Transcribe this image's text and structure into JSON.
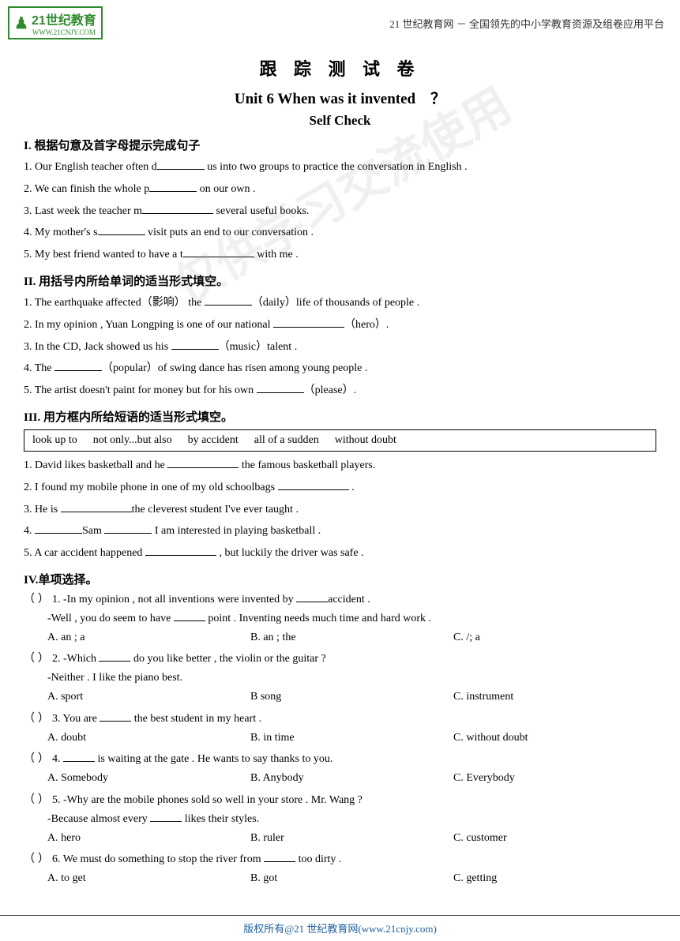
{
  "header": {
    "logo_text": "21世纪教育",
    "logo_sub": "WWW.21CNJY.COM",
    "tagline": "21 世纪教育网 － 全国领先的中小学教育资源及组卷应用平台"
  },
  "main_title": "跟 踪 测 试 卷",
  "subtitle": "Unit 6 When was it invented　？",
  "self_check": "Self Check",
  "section1": {
    "title": "I.  根据句意及首字母提示完成句子",
    "questions": [
      "1.  Our English teacher often d______ us into two groups to practice the conversation in English .",
      "2.  We can finish the whole p______ on our own .",
      "3.  Last week the teacher m_______ several useful books.",
      "4.  My mother's s______ visit puts an end to our conversation .",
      "5.  My best friend wanted to have a t________ with me ."
    ]
  },
  "section2": {
    "title": "II. 用括号内所给单词的适当形式填空。",
    "questions": [
      "1.  The earthquake affected（影响） the _______ （daily）life of thousands of people .",
      "2.  In my opinion , Yuan Longping is one of our national _______（hero）.",
      "3.  In the CD, Jack showed us his _____（music）talent .",
      "4.  The _______ （popular）of swing dance has risen among young people .",
      "5.  The artist doesn't paint for money but for his own _____ （please）."
    ]
  },
  "section3": {
    "title": "III. 用方框内所给短语的适当形式填空。",
    "box_items": [
      "look up to",
      "not only...but also",
      "by accident",
      "all of a sudden",
      "without doubt"
    ],
    "questions": [
      "1.  David likes basketball and he _________ the famous basketball players.",
      "2.  I found my mobile phone in one of my old schoolbags _____________ .",
      "3.  He is ____________the cleverest student I've ever taught .",
      "4.  ________Sam _____________ I am interested in playing basketball .",
      "5.  A car accident happened _____________ , but luckily the driver was safe ."
    ]
  },
  "section4": {
    "title": "IV.单项选择。",
    "questions": [
      {
        "num": "1",
        "stem": "-In my opinion , not all inventions were invented by _____accident .",
        "stem2": "-Well , you do seem to have ______ point . Inventing needs much time and hard work .",
        "options": [
          "A. an ; a",
          "B. an ; the",
          "C. /; a"
        ]
      },
      {
        "num": "2",
        "stem": "-Which _____ do you like better , the violin or the guitar ?",
        "stem2": "-Neither . I like the piano best.",
        "options": [
          "A. sport",
          "B song",
          "C. instrument"
        ]
      },
      {
        "num": "3",
        "stem": "You are ______ the best student in my heart .",
        "stem2": "",
        "options": [
          "A. doubt",
          "B. in time",
          "C. without doubt"
        ]
      },
      {
        "num": "4",
        "stem": "______ is waiting at the gate . He wants to say thanks to you.",
        "stem2": "",
        "options": [
          "A. Somebody",
          "B. Anybody",
          "C. Everybody"
        ]
      },
      {
        "num": "5",
        "stem": "-Why are the mobile phones sold so well in your store . Mr. Wang ?",
        "stem2": "-Because almost every ______ likes their styles.",
        "options": [
          "A. hero",
          "B. ruler",
          "C. customer"
        ]
      },
      {
        "num": "6",
        "stem": "We must do something to stop the river from ______ too dirty .",
        "stem2": "",
        "options": [
          "A. to get",
          "B. got",
          "C. getting"
        ]
      }
    ]
  },
  "footer": {
    "text": "版权所有@21 世纪教育网(www.21cnjy.com)"
  }
}
